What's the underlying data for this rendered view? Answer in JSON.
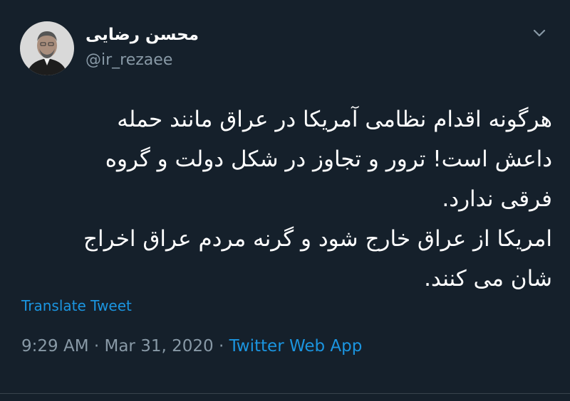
{
  "tweet": {
    "display_name": "محسن رضایی",
    "handle": "@ir_rezaee",
    "body_lines": [
      "هرگونه اقدام نظامی آمریکا در عراق مانند حمله",
      "داعش است! ترور و تجاوز در شکل دولت و گروه",
      "فرقی ندارد.",
      "امریکا از عراق خارج شود و گرنه مردم عراق اخراج",
      "شان می کنند."
    ],
    "translate_label": "Translate Tweet",
    "time": "9:29 AM",
    "separator": "·",
    "date": "Mar 31, 2020",
    "source": "Twitter Web App"
  },
  "icons": {
    "menu": "chevron-down-icon",
    "avatar": "profile-photo"
  },
  "colors": {
    "background": "#15202b",
    "text": "#ffffff",
    "secondary": "#8899a6",
    "link": "#1b95e0"
  }
}
